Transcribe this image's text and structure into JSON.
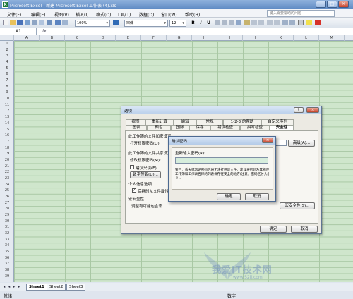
{
  "window": {
    "title": "Microsoft Excel - 新建 Microsoft Excel 工作表 (4).xls",
    "app_icon": "excel-icon"
  },
  "menu": [
    "文件(F)",
    "编辑(E)",
    "视图(V)",
    "插入(I)",
    "格式(O)",
    "工具(T)",
    "数据(D)",
    "窗口(W)",
    "帮助(H)"
  ],
  "help_search": {
    "placeholder": "键入需要帮助的问题"
  },
  "toolbar": {
    "zoom": "100%",
    "font": "宋体",
    "size": "12"
  },
  "formula_bar": {
    "name_box": "A1",
    "fx": "fx"
  },
  "columns": [
    "A",
    "B",
    "C",
    "D",
    "E",
    "F",
    "G",
    "H",
    "I",
    "J",
    "K",
    "L",
    "M"
  ],
  "rows": [
    "1",
    "2",
    "3",
    "4",
    "5",
    "6",
    "7",
    "8",
    "9",
    "10",
    "11",
    "12",
    "13",
    "14",
    "15",
    "16",
    "17",
    "18",
    "19",
    "20",
    "21",
    "22",
    "23",
    "24",
    "25",
    "26",
    "27",
    "28",
    "29",
    "30",
    "31",
    "32",
    "33",
    "34",
    "35",
    "36",
    "37",
    "38",
    "39"
  ],
  "sheets": [
    "Sheet1",
    "Sheet2",
    "Sheet3"
  ],
  "status": {
    "left": "就绪",
    "right": "数字"
  },
  "options_dialog": {
    "title": "选项",
    "tabs_row1": [
      "视图",
      "重新计算",
      "编辑",
      "常规",
      "1-2-3 的帮助",
      "自定义序列"
    ],
    "tabs_row2": [
      "图表",
      "颜色",
      "国际",
      "保存",
      "错误检查",
      "拼写检查",
      "安全性"
    ],
    "section_open": "此工作簿的文件加密设置",
    "open_pwd_label": "打开权限密码(O):",
    "advanced_btn": "高级(A)...",
    "section_share": "此工作簿的文件共享设置",
    "modify_pwd_label": "修改权限密码(M):",
    "readonly_label": "建议只读(E)",
    "digital_sig_btn": "数字签名(D)...",
    "privacy_section": "个人信息选项",
    "privacy_check_label": "保存时从文件属性",
    "macro_section": "宏安全性",
    "macro_desc": "调整有可能包含宏",
    "macro_btn": "宏安全性(S)...",
    "ok": "确定",
    "cancel": "取消"
  },
  "confirm_dialog": {
    "title": "确认密码",
    "reenter_label": "重新输入密码(R):",
    "warning": "警告：丢失或忘记密码后将无法打开该文件。建议将密码及其相应工作簿和工作表名称的列表保存在安全的地方(注意，密码区分大小写)。",
    "ok": "确定",
    "cancel": "取消"
  },
  "watermark": {
    "text": "我爱IT技术网",
    "url": "www.52ij.com"
  }
}
